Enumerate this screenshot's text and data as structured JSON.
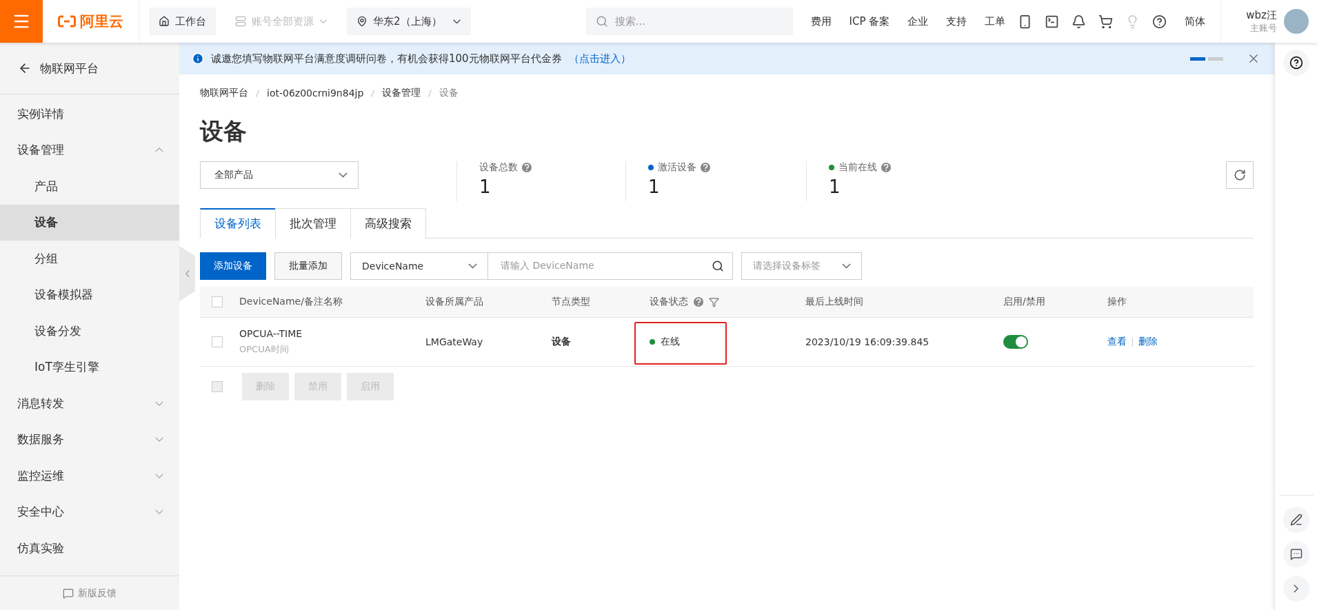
{
  "topbar": {
    "logo": "阿里云",
    "workbench": "工作台",
    "account_scope": {
      "label": "账号全部资源",
      "disabled": true
    },
    "region": "华东2（上海）",
    "search": {
      "placeholder": "搜索..."
    },
    "links": [
      "费用",
      "ICP 备案",
      "企业",
      "支持",
      "工单"
    ],
    "icons": [
      {
        "kind": "app",
        "disabled": false
      },
      {
        "kind": "terminal",
        "disabled": false
      },
      {
        "kind": "bell",
        "disabled": false
      },
      {
        "kind": "cart",
        "disabled": false
      },
      {
        "kind": "bulb",
        "disabled": true
      },
      {
        "kind": "help",
        "disabled": false
      }
    ],
    "language": "简体",
    "user": {
      "name": "wbz汪",
      "role": "主账号"
    }
  },
  "sidebar": {
    "back": "物联网平台",
    "items": [
      {
        "label": "实例详情",
        "selected": false
      },
      {
        "label": "设备管理",
        "expanded": true,
        "selected": false,
        "children": [
          {
            "label": "产品",
            "selected": false
          },
          {
            "label": "设备",
            "selected": true
          },
          {
            "label": "分组",
            "selected": false
          },
          {
            "label": "设备模拟器",
            "selected": false
          },
          {
            "label": "设备分发",
            "selected": false
          },
          {
            "label": "IoT孪生引擎",
            "selected": false
          }
        ]
      },
      {
        "label": "消息转发",
        "expanded": false,
        "selected": false
      },
      {
        "label": "数据服务",
        "expanded": false,
        "selected": false
      },
      {
        "label": "监控运维",
        "expanded": false,
        "selected": false
      },
      {
        "label": "安全中心",
        "expanded": false,
        "selected": false
      },
      {
        "label": "仿真实验",
        "selected": false
      }
    ],
    "feedback": "新版反馈"
  },
  "banner": {
    "text": "诚邀您填写物联网平台满意度调研问卷，有机会获得100元物联网平台代金券",
    "link": "（点击进入）",
    "pager": [
      {
        "selected": true
      },
      {
        "selected": false
      }
    ]
  },
  "breadcrumb": [
    {
      "label": "物联网平台",
      "current": false
    },
    {
      "label": "iot-06z00crni9n84jp",
      "current": false
    },
    {
      "label": "设备管理",
      "current": false
    },
    {
      "label": "设备",
      "current": true
    }
  ],
  "page_title": "设备",
  "product_select": "全部产品",
  "stats": [
    {
      "label": "设备总数",
      "value": "1"
    },
    {
      "label": "激活设备",
      "value": "1",
      "color": "#0064c8"
    },
    {
      "label": "当前在线",
      "value": "1",
      "color": "#1e8e3e"
    }
  ],
  "tabs": [
    {
      "label": "设备列表",
      "selected": true
    },
    {
      "label": "批次管理",
      "selected": false
    },
    {
      "label": "高级搜索",
      "selected": false
    }
  ],
  "toolbar": {
    "add": "添加设备",
    "batch_add": "批量添加",
    "field_select": "DeviceName",
    "search": {
      "placeholder": "请输入 DeviceName"
    },
    "tag_select": {
      "placeholder": "请选择设备标签"
    }
  },
  "table": {
    "select_all_checked": false,
    "columns": [
      "DeviceName/备注名称",
      "设备所属产品",
      "节点类型",
      "设备状态",
      "最后上线时间",
      "启用/禁用",
      "操作"
    ],
    "rows": [
      {
        "checked": false,
        "name": "OPCUA--TIME",
        "note": "OPCUA时间",
        "product": "LMGateWay",
        "node_type": "设备",
        "status": {
          "label": "在线",
          "color": "#1e8e3e"
        },
        "status_highlighted": true,
        "last_online": "2023/10/19 16:09:39.845",
        "enabled": true,
        "actions": [
          "查看",
          "删除"
        ]
      }
    ],
    "bulk_checkbox": {
      "checked": false,
      "disabled": true
    },
    "bulk_actions": [
      {
        "label": "删除",
        "disabled": true
      },
      {
        "label": "禁用",
        "disabled": true
      },
      {
        "label": "启用",
        "disabled": true
      }
    ]
  }
}
